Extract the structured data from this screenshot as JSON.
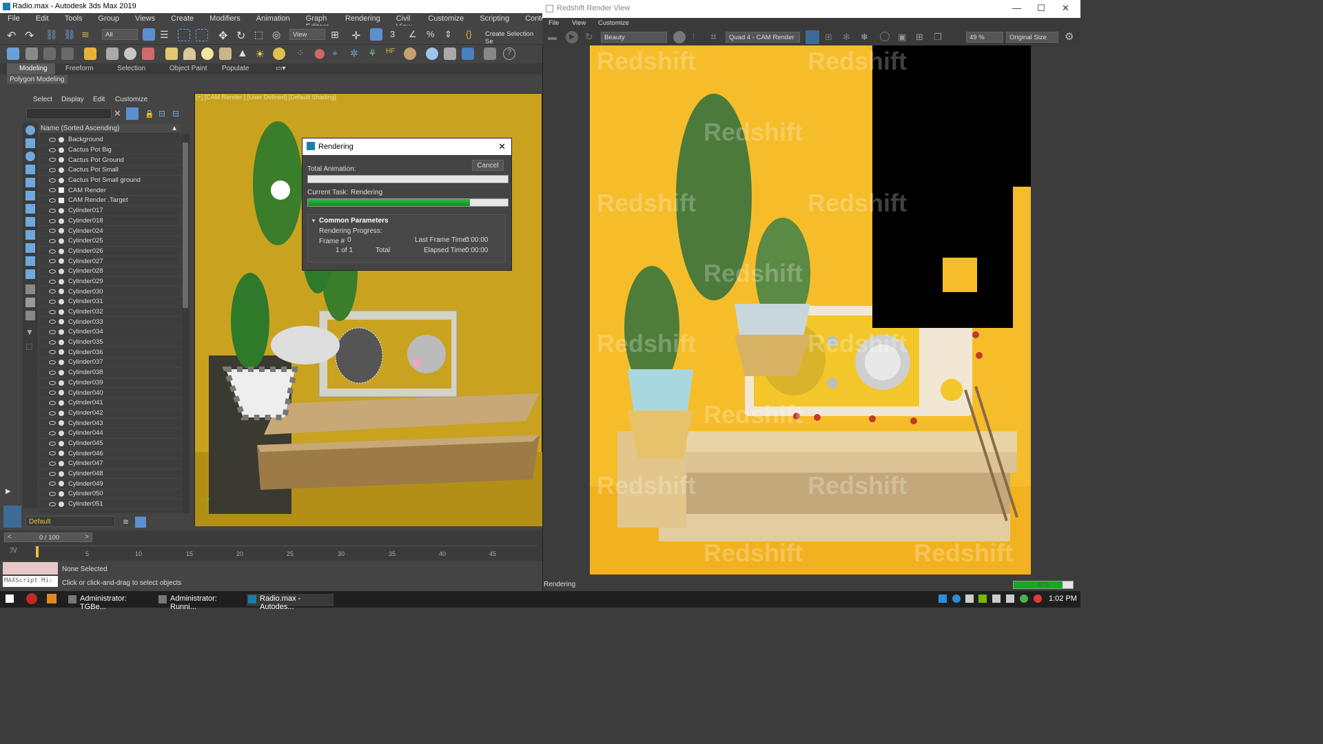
{
  "max": {
    "title": "Radio.max - Autodesk 3ds Max 2019",
    "menu": [
      "File",
      "Edit",
      "Tools",
      "Group",
      "Views",
      "Create",
      "Modifiers",
      "Animation",
      "Graph Editors",
      "Rendering",
      "Civil View",
      "Customize",
      "Scripting",
      "Content"
    ],
    "selection_filter": "All",
    "ref_coord": "View",
    "named_selection": "Create Selection Se",
    "ribbon_tabs": [
      "Modeling",
      "Freeform",
      "Selection",
      "Object Paint",
      "Populate"
    ],
    "ribbon_panel": "Polygon Modeling",
    "scene_explorer": {
      "menu": [
        "Select",
        "Display",
        "Edit",
        "Customize"
      ],
      "column": "Name (Sorted Ascending)",
      "objects": [
        "Background",
        "Cactus Pot Big",
        "Cactus Pot Ground",
        "Cactus Pot Small",
        "Cactus Pot Small ground",
        "CAM Render",
        "CAM Render .Target",
        "Cylinder017",
        "Cylinder018",
        "Cylinder024",
        "Cylinder025",
        "Cylinder026",
        "Cylinder027",
        "Cylinder028",
        "Cylinder029",
        "Cylinder030",
        "Cylinder031",
        "Cylinder032",
        "Cylinder033",
        "Cylinder034",
        "Cylinder035",
        "Cylinder036",
        "Cylinder037",
        "Cylinder038",
        "Cylinder039",
        "Cylinder040",
        "Cylinder041",
        "Cylinder042",
        "Cylinder043",
        "Cylinder044",
        "Cylinder045",
        "Cylinder046",
        "Cylinder047",
        "Cylinder048",
        "Cylinder049",
        "Cylinder050",
        "Cylinder051"
      ],
      "layer": "Default"
    },
    "viewport_label": "[+] [CAM Render ] [User Defined] [Default Shading]",
    "time_slider": "0 / 100",
    "timeline_ticks": [
      "5",
      "10",
      "15",
      "20",
      "25",
      "30",
      "35",
      "40",
      "45"
    ],
    "status": {
      "selection": "None Selected",
      "prompt": "Click or click-and-drag to select objects",
      "script": "MAXScript Mi:"
    }
  },
  "dialog": {
    "title": "Rendering",
    "cancel": "Cancel",
    "total_animation": "Total Animation:",
    "current_task_label": "Current Task:",
    "current_task": "Rendering",
    "progress": 0.81,
    "section": "Common Parameters",
    "rendering_progress": "Rendering Progress:",
    "frame_label": "Frame #",
    "frame": "0",
    "of": "1 of 1",
    "total": "Total",
    "last_frame_time_label": "Last Frame Time:",
    "last_frame_time": "0:00:00",
    "elapsed_label": "Elapsed Time:",
    "elapsed": "0:00:00"
  },
  "rs": {
    "title": "Redshift Render View",
    "menu": [
      "File",
      "View",
      "Customize"
    ],
    "aov": "Beauty",
    "camera": "Quad 4 - CAM Render",
    "zoom": "49 %",
    "size": "Original Size",
    "watermark": "Redshift",
    "status": "Rendering",
    "progress": 0.82,
    "progress_text": "82%"
  },
  "taskbar": {
    "items": [
      "Administrator: TGBe...",
      "Administrator: Runni...",
      "Radio.max - Autodes..."
    ],
    "time": "1:02 PM"
  }
}
